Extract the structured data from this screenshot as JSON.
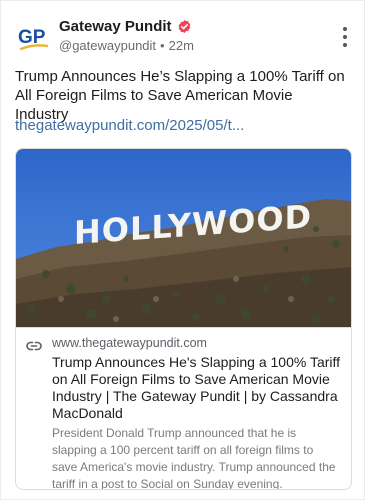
{
  "post": {
    "author": {
      "name": "Gateway Pundit",
      "handle": "@gatewaypundit",
      "separator": "•",
      "time": "22m",
      "avatar_text": "GP",
      "verified": true
    },
    "text": "Trump Announces He’s Slapping a 100% Tariff on All Foreign Films to Save American Movie Industry",
    "link_text": "thegatewaypundit.com/2025/05/t...",
    "colors": {
      "link": "#3d6fa5",
      "verified_badge": "#f0435a",
      "avatar_blue": "#1b4fa0",
      "avatar_gold": "#e8b631"
    }
  },
  "card": {
    "image_text": "HOLLYWOOD",
    "domain": "www.thegatewaypundit.com",
    "title": "Trump Announces He's Slapping a 100% Tariff on All Foreign Films to Save American Movie Industry | The Gateway Pundit | by Cassandra MacDonald",
    "description": "President Donald Trump announced that he is slapping a 100 percent tariff on all foreign films to save America's movie industry. Trump announced the tariff in a post to Social on Sunday evening.",
    "link_icon": "link-icon"
  },
  "icons": {
    "more": "more-vertical-icon",
    "verified": "verified-badge-icon"
  }
}
